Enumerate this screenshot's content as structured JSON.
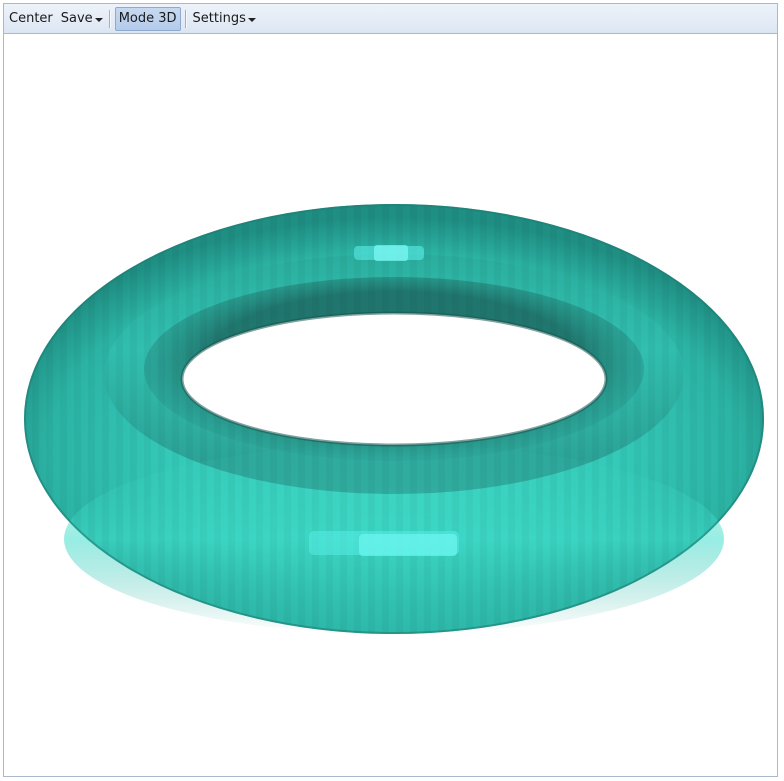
{
  "toolbar": {
    "center_label": "Center",
    "save_label": "Save",
    "mode_label": "Mode 3D",
    "settings_label": "Settings"
  },
  "viewport": {
    "object": "torus",
    "surface_color": "#2fc4b2",
    "highlight_color": "#5ff2ec",
    "shadow_color": "#1d6a63",
    "background": "#ffffff"
  },
  "icons": {
    "save_dropdown": "chevron-down-icon",
    "settings_dropdown": "chevron-down-icon"
  }
}
